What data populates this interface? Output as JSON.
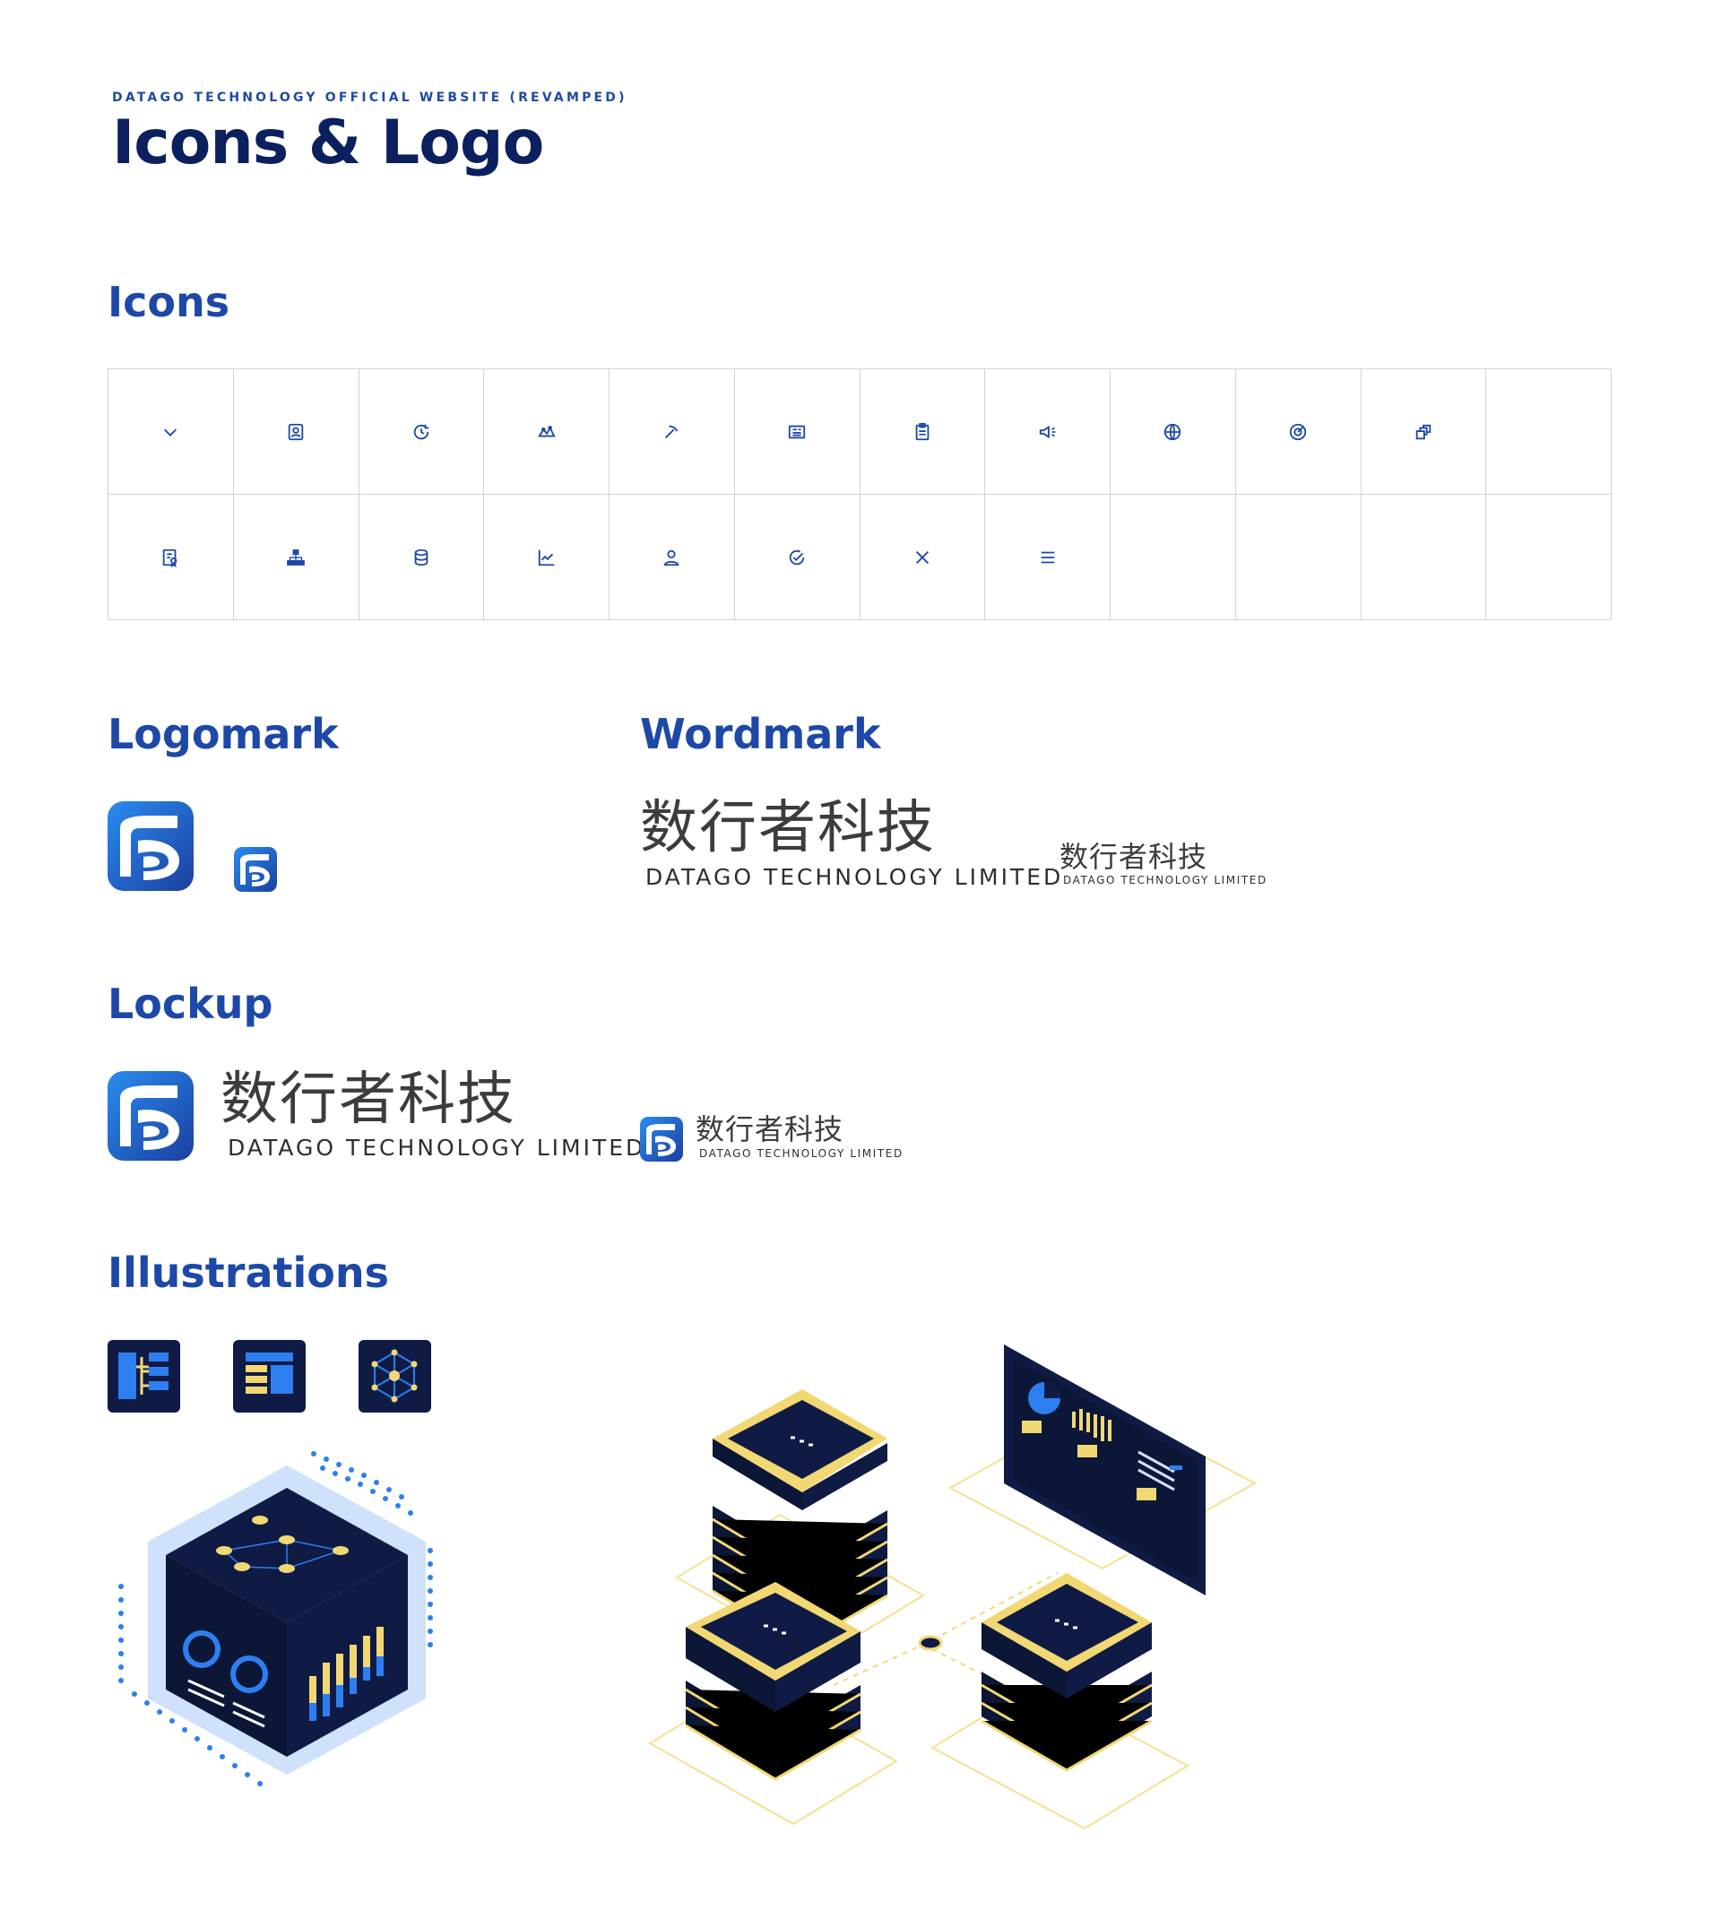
{
  "header": {
    "eyebrow": "DATAGO TECHNOLOGY OFFICIAL WEBSITE (REVAMPED)",
    "title": "Icons & Logo"
  },
  "sections": {
    "icons": "Icons",
    "logomark": "Logomark",
    "wordmark": "Wordmark",
    "lockup": "Lockup",
    "illustrations": "Illustrations"
  },
  "brand": {
    "name_cn": "数行者科技",
    "name_en": "DATAGO TECHNOLOGY LIMITED"
  },
  "icons": [
    "chevron-down-icon",
    "id-badge-icon",
    "refresh-icon",
    "cloud-network-icon",
    "pickaxe-icon",
    "newspaper-icon",
    "clipboard-icon",
    "megaphone-icon",
    "globe-icon",
    "target-icon",
    "layers-icon",
    "",
    "certificate-icon",
    "org-chart-icon",
    "database-icon",
    "line-chart-icon",
    "user-icon",
    "check-badge-icon",
    "close-icon",
    "menu-icon",
    "",
    "",
    "",
    ""
  ],
  "colors": {
    "primary": "#1d48a8",
    "navy": "#0c1f5e",
    "dark_navy": "#0f1b45",
    "accent_yellow": "#f2d873",
    "light_blue": "#cfe1fb",
    "bright_blue": "#2d7ff0"
  }
}
